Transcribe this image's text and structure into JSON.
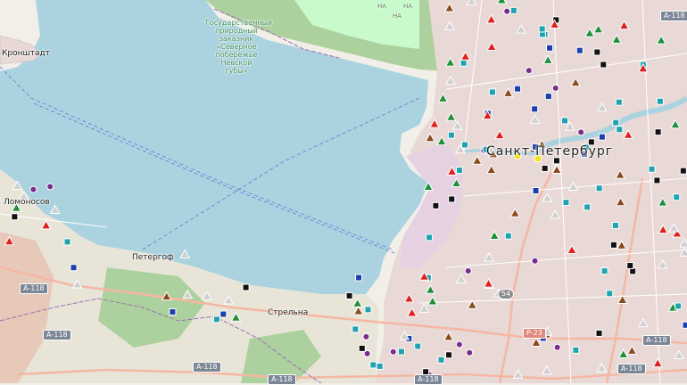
{
  "labels": {
    "kronstadt": "Кронштадт",
    "reserve": [
      "Государственный",
      "природный",
      "заказник",
      "«Северное",
      "побережье",
      "Невской",
      "губы»"
    ],
    "lomonosov": "Ломоносов",
    "peterhof": "Петергоф",
    "strelna": "Стрельна",
    "city": "Санкт-Петербург",
    "na": "НА"
  },
  "road_shields": {
    "a118": "А-118",
    "p23": "Р-23",
    "r54": "54"
  },
  "colors": {
    "water": "#aad3df",
    "land": "#f2efe9",
    "forest": "#add19e",
    "park": "#c8facc",
    "urban": "#e8d9d6",
    "industrial": "#e6d1e3",
    "road_major": "#f5b7a3",
    "road_minor": "#ffffff",
    "boundary": "#9c6fb0",
    "ferry": "#6a7fd8",
    "marker_teal": "#1fa3b0",
    "marker_gray": "#d0d0d0",
    "marker_black": "#111111",
    "marker_red": "#e0201e",
    "marker_green": "#1f8f3a",
    "marker_brown": "#8a4b1c",
    "marker_purple": "#7a2a8c",
    "marker_blue": "#1c3fae",
    "marker_yellow": "#f2e21a"
  }
}
